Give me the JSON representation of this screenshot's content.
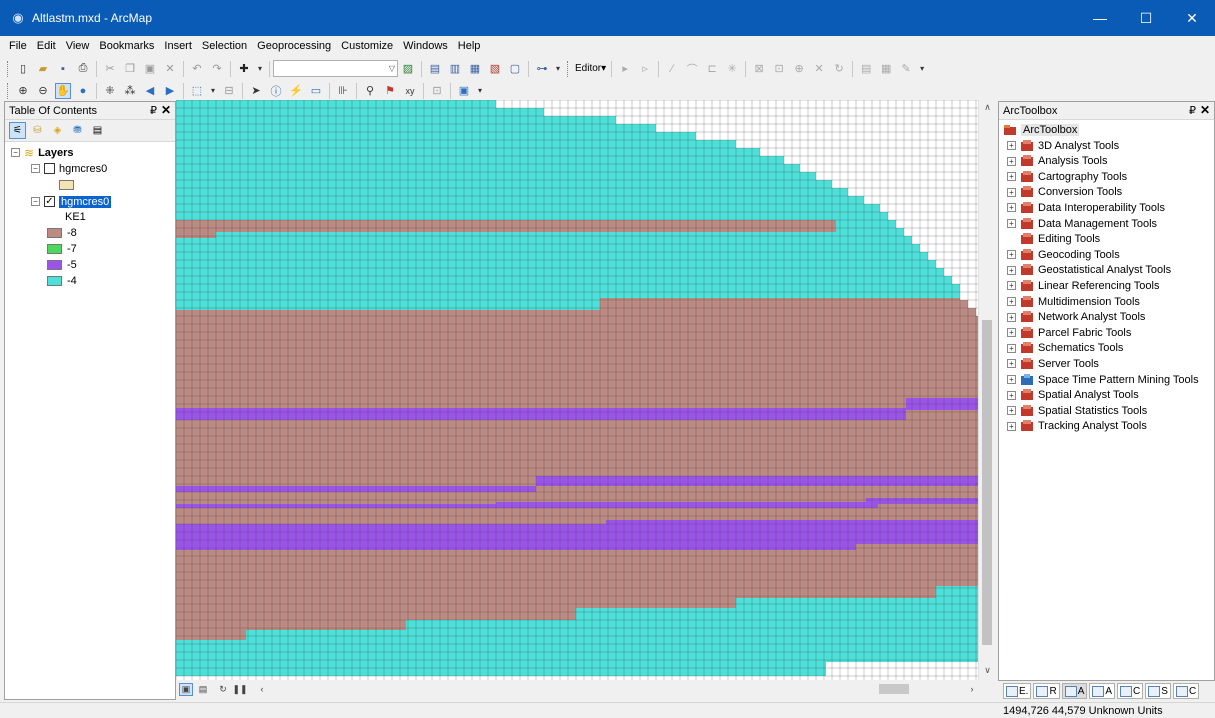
{
  "window": {
    "title": "Altlastm.mxd - ArcMap",
    "minimize": "—",
    "maximize": "☐",
    "close": "✕"
  },
  "menu": [
    "File",
    "Edit",
    "View",
    "Bookmarks",
    "Insert",
    "Selection",
    "Geoprocessing",
    "Customize",
    "Windows",
    "Help"
  ],
  "toolbar": {
    "editor_label": "Editor▾",
    "scale_value": ""
  },
  "toc": {
    "title": "Table Of Contents",
    "pin": "₽",
    "close": "✕",
    "root_label": "Layers",
    "layers": [
      {
        "name": "hgmcres0",
        "checked": false,
        "selected": false
      },
      {
        "name": "hgmcres0",
        "checked": true,
        "selected": true
      }
    ],
    "field_label": "KE1",
    "legend": [
      {
        "label": "-8",
        "color": "#bc8a82"
      },
      {
        "label": "-7",
        "color": "#4cd85a"
      },
      {
        "label": "-5",
        "color": "#9a55e8"
      },
      {
        "label": "-4",
        "color": "#4ce0d8"
      }
    ],
    "first_layer_color": "#f4e3b4"
  },
  "map": {
    "colors": {
      "brown": "#bc8a82",
      "purple": "#9a55e8",
      "cyan": "#4ce0d8",
      "grid": "#3c3c3c"
    }
  },
  "toolbox": {
    "title": "ArcToolbox",
    "pin": "₽",
    "close": "✕",
    "root_label": "ArcToolbox",
    "tools": [
      "3D Analyst Tools",
      "Analysis Tools",
      "Cartography Tools",
      "Conversion Tools",
      "Data Interoperability Tools",
      "Data Management Tools",
      "Editing Tools",
      "Geocoding Tools",
      "Geostatistical Analyst Tools",
      "Linear Referencing Tools",
      "Multidimension Tools",
      "Network Analyst Tools",
      "Parcel Fabric Tools",
      "Schematics Tools",
      "Server Tools",
      "Space Time Pattern Mining Tools",
      "Spatial Analyst Tools",
      "Spatial Statistics Tools",
      "Tracking Analyst Tools"
    ],
    "no_expander": [
      "Editing Tools"
    ],
    "tabs": [
      "E.",
      "R",
      "A",
      "A",
      "C",
      "S",
      "C"
    ]
  },
  "status": {
    "coordinates": "1494,726 44,579 Unknown Units"
  }
}
